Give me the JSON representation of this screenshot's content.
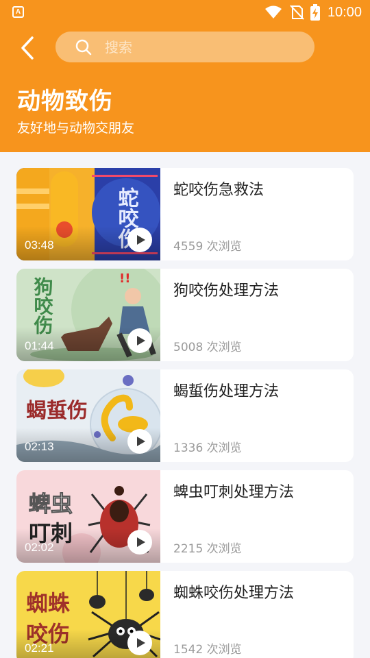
{
  "status": {
    "time": "10:00",
    "icons": [
      "wifi-icon",
      "no-sim-icon",
      "battery-charging-icon"
    ]
  },
  "header": {
    "back_icon": "back-arrow-icon",
    "search": {
      "placeholder": "搜索",
      "icon": "search-icon"
    },
    "title": "动物致伤",
    "subtitle": "友好地与动物交朋友"
  },
  "videos": [
    {
      "title": "蛇咬伤急救法",
      "duration": "03:48",
      "views": "4559 次浏览",
      "thumb_text": "蛇咬伤"
    },
    {
      "title": "狗咬伤处理方法",
      "duration": "01:44",
      "views": "5008 次浏览",
      "thumb_text": "狗咬伤"
    },
    {
      "title": "蝎蜇伤处理方法",
      "duration": "02:13",
      "views": "1336 次浏览",
      "thumb_text": "蝎蜇伤"
    },
    {
      "title": "蜱虫叮刺处理方法",
      "duration": "02:02",
      "views": "2215 次浏览",
      "thumb_text_1": "蜱虫",
      "thumb_text_2": "叮刺"
    },
    {
      "title": "蜘蛛咬伤处理方法",
      "duration": "02:21",
      "views": "1542 次浏览",
      "thumb_text_1": "蜘蛛",
      "thumb_text_2": "咬伤"
    }
  ],
  "colors": {
    "accent": "#f7941d",
    "search_bg": "#f9be74",
    "page_bg": "#f4f5f9"
  }
}
